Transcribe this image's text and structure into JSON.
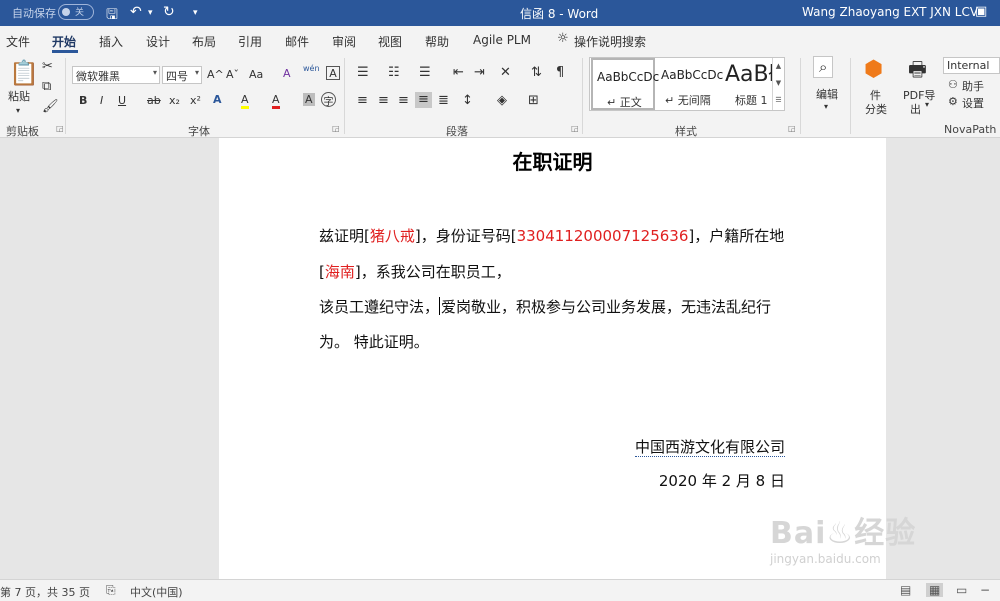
{
  "titlebar": {
    "autosave_label": "自动保存",
    "autosave_state": "关",
    "title": "信函 8  -  Word",
    "user": "Wang Zhaoyang EXT JXN LCV"
  },
  "tabs": [
    "文件",
    "开始",
    "插入",
    "设计",
    "布局",
    "引用",
    "邮件",
    "审阅",
    "视图",
    "帮助",
    "Agile PLM"
  ],
  "active_tab": "开始",
  "tell_me": "操作说明搜索",
  "ribbon": {
    "clipboard": {
      "paste_label": "粘贴",
      "group_label": "剪贴板"
    },
    "font": {
      "font_name": "微软雅黑",
      "font_size": "四号",
      "group_label": "字体",
      "bold": "B",
      "italic": "I",
      "underline": "U",
      "strike": "ab",
      "subscript": "x₂",
      "superscript": "x²",
      "grow": "A^",
      "shrink": "Aˇ",
      "case": "Aa",
      "clear": "A",
      "phonetic": "wén",
      "highlight": "A",
      "font_color": "A",
      "shade": "A",
      "enclose": "字"
    },
    "paragraph": {
      "group_label": "段落"
    },
    "styles": {
      "group_label": "样式",
      "items": [
        {
          "preview": "AaBbCcDc",
          "name": "↵ 正文"
        },
        {
          "preview": "AaBbCcDc",
          "name": "↵ 无间隔"
        },
        {
          "preview": "AaBł",
          "name": "标题 1"
        }
      ]
    },
    "editing": {
      "label": "编辑"
    },
    "addins": {
      "file_label": "件",
      "file_label2": "分类",
      "pdf_label": "PDF导",
      "pdf_label2": "出",
      "pdf_arrow": "▾"
    },
    "novapath": {
      "internal": "Internal",
      "helper": "助手",
      "settings": "设置",
      "group_label": "NovaPath"
    }
  },
  "document": {
    "heading": "在职证明",
    "lines": {
      "l1_a": "兹证明[",
      "l1_name": "猪八戒",
      "l1_b": "]，身份证号码[",
      "l1_id": "330411200007125636",
      "l1_c": "]，户籍所在地",
      "l2_a": "[",
      "l2_place": "海南",
      "l2_b": "]，系我公司在职员工，",
      "l3_a": "该员工遵纪守法，",
      "l3_b": "爱岗敬业，积极参与公司业务发展，无违法乱纪行",
      "l4": "为。  特此证明。"
    },
    "company": "中国西游文化有限公司",
    "date": "2020 年 2 月 8 日"
  },
  "watermark": {
    "brand": "Bai♨经验",
    "url": "jingyan.baidu.com"
  },
  "statusbar": {
    "page": "第 7 页，共 35 页",
    "language": "中文(中国)"
  }
}
